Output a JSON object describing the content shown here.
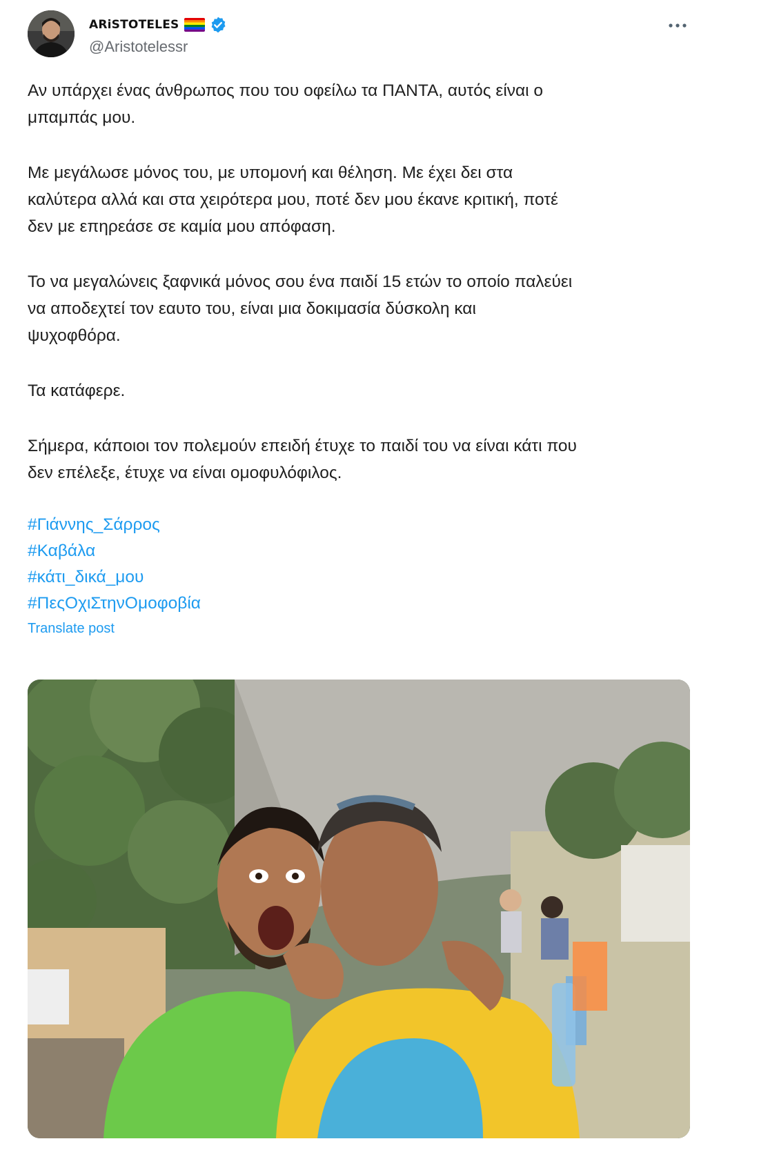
{
  "author": {
    "display_name": "ARiSTOTELES",
    "handle": "@Aristotelessr",
    "avatar_icon": "avatar-photo",
    "flag_icon": "rainbow-flag-icon",
    "verified_icon": "verified-badge-icon"
  },
  "menu": {
    "more_icon": "more-options-icon"
  },
  "tweet": {
    "paragraphs": [
      "Αν υπάρχει ένας άνθρωπος που του οφείλω τα ΠΑΝΤΑ, αυτός είναι ο\nμπαμπάς μου.",
      "Με μεγάλωσε μόνος του, με υπομονή και θέληση. Με έχει δει στα\nκαλύτερα αλλά και στα χειρότερα μου, ποτέ δεν μου έκανε κριτική, ποτέ\nδεν με επηρεάσε σε καμία μου απόφαση.",
      "Το να μεγαλώνεις ξαφνικά μόνος σου ένα παιδί 15 ετών το οποίο παλεύει\nνα αποδεχτεί τον εαυτο του, είναι μια δοκιμασία δύσκολη και\nψυχοφθόρα.",
      "Τα κατάφερε.",
      "Σήμερα, κάποιοι τον πολεμούν επειδή έτυχε το παιδί του να είναι κάτι που\nδεν επέλεξε, έτυχε να είναι ομοφυλόφιλος."
    ],
    "hashtags": [
      "#Γιάννης_Σάρρος",
      "#Καβάλα",
      "#κάτι_δικά_μου",
      "#ΠεςΟχιΣτηνΟμοφοβία"
    ],
    "translate_label": "Translate post"
  },
  "media": {
    "type": "photo",
    "alt_icon": "photo-two-men-outdoor-cafe"
  },
  "colors": {
    "link": "#1d9bf0",
    "text": "#1f1f1f",
    "muted": "#666a6f",
    "verified": "#1d9bf0"
  }
}
